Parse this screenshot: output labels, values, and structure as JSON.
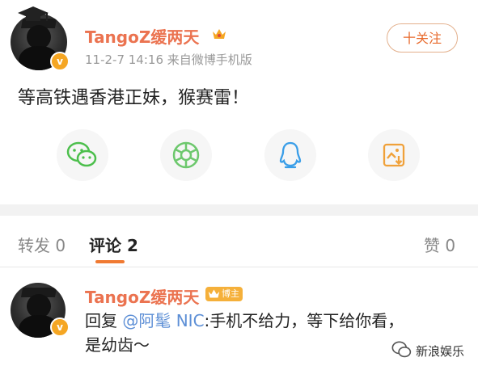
{
  "post": {
    "username": "TangoZ缓两天",
    "meta": "11-2-7 14:16  来自微博手机版",
    "follow_label": "十关注",
    "content": "等高铁遇香港正妹，猴赛雷！",
    "verified_mark": "v"
  },
  "share_icons": [
    "wechat-icon",
    "moments-icon",
    "qq-icon",
    "save-image-icon"
  ],
  "tabs": {
    "repost": "转发 0",
    "comments": "评论 2",
    "likes": "赞 0"
  },
  "comment": {
    "username": "TangoZ缓两天",
    "badge": "博主",
    "reply_prefix": "回复",
    "mention": "@阿髦 NIC",
    "reply_text": ":手机不给力，等下给你看，",
    "reply_text2": "是幼齿～"
  },
  "watermark": "新浪娱乐",
  "colors": {
    "accent": "#eb7350",
    "tab_underline": "#f07a32",
    "mention": "#5d8fd6",
    "badge": "#f5b03a"
  }
}
